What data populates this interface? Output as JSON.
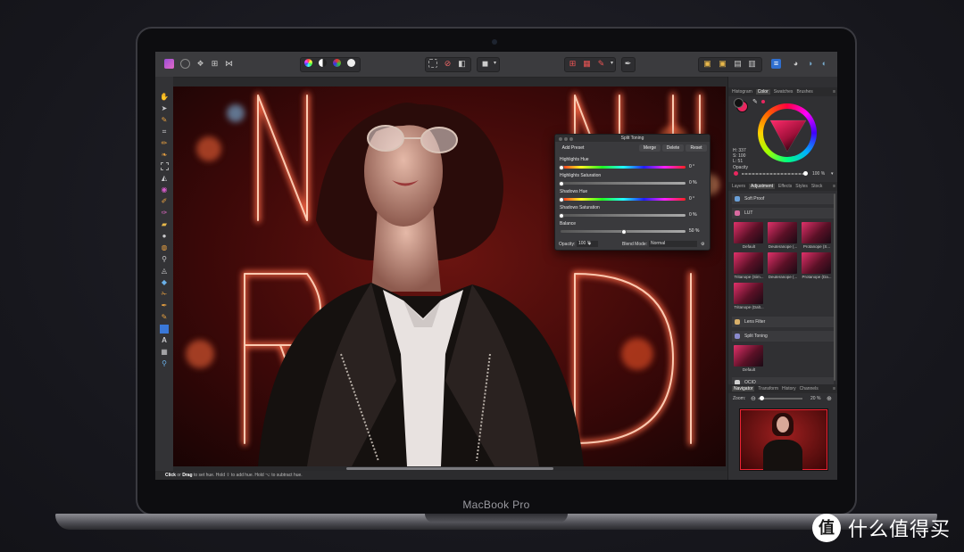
{
  "device": {
    "label": "MacBook Pro"
  },
  "app": {
    "status_hint_parts": [
      {
        "text": "Click",
        "bold": true
      },
      {
        "text": " or ",
        "bold": false
      },
      {
        "text": "Drag",
        "bold": true
      },
      {
        "text": " to set hue. Hold ⇧ to add hue. Hold ⌥ to subtract hue.",
        "bold": false
      }
    ]
  },
  "toolbar": {
    "left_icons": [
      "app-logo-icon",
      "persona-photo-icon",
      "persona-liquify-icon",
      "persona-develop-icon",
      "persona-export-icon"
    ],
    "mid_icons": [
      "auto-levels-icon",
      "auto-contrast-icon",
      "auto-colors-icon",
      "auto-white-balance-icon"
    ],
    "select_icons": [
      "marquee-icon",
      "deselect-icon",
      "invert-selection-icon"
    ],
    "quickmask": "quick-mask-icon",
    "snap_icons": [
      "snapping-icon",
      "grid-icon",
      "brush-icon"
    ],
    "arrange_icons": [
      "arrange-back-icon",
      "arrange-front-icon",
      "arrange-icon"
    ],
    "right_icons": [
      "view-mode-icon",
      "boolean-add-icon",
      "boolean-subtract-icon",
      "boolean-intersect-icon"
    ]
  },
  "tools": [
    "hand-tool-icon",
    "move-tool-icon",
    "color-picker-icon",
    "crop-tool-icon",
    "paint-brush-icon",
    "smudge-icon",
    "selection-brush-icon",
    "flood-fill-icon",
    "gradient-icon",
    "paint-icon",
    "pixel-icon",
    "erase-icon",
    "dodge-icon",
    "sponge-icon",
    "clone-icon",
    "blur-icon",
    "sharpen-icon",
    "retouch-icon",
    "pen-icon",
    "node-icon",
    "shape-icon",
    "text-icon",
    "mesh-warp-icon",
    "zoom-tool-icon"
  ],
  "split_toning": {
    "title": "Split Toning",
    "buttons": {
      "add_preset": "Add Preset",
      "merge": "Merge",
      "delete": "Delete",
      "reset": "Reset"
    },
    "controls": [
      {
        "label": "Highlights Hue",
        "value": "0 °",
        "position": 0.0,
        "kind": "hue"
      },
      {
        "label": "Highlights Saturation",
        "value": "0 %",
        "position": 0.0,
        "kind": "gray"
      },
      {
        "label": "Shadows Hue",
        "value": "0 °",
        "position": 0.0,
        "kind": "hue"
      },
      {
        "label": "Shadows Saturation",
        "value": "0 %",
        "position": 0.0,
        "kind": "gray"
      },
      {
        "label": "Balance",
        "value": "50 %",
        "position": 0.5,
        "kind": "gray"
      }
    ],
    "opacity_label": "Opacity:",
    "opacity_value": "100 %",
    "blend_label": "Blend Mode:",
    "blend_value": "Normal"
  },
  "color_panel": {
    "tabs": [
      "Histogram",
      "Color",
      "Swatches",
      "Brushes"
    ],
    "active_tab": "Color",
    "readout_h": "H: 337",
    "readout_s": "S: 100",
    "readout_l": "L: 51",
    "opacity_label": "Opacity",
    "opacity_value": "100 %",
    "accent": "#e8275f"
  },
  "adjustment_panel": {
    "tabs": [
      "Layers",
      "Adjustment",
      "Effects",
      "Styles",
      "Stock"
    ],
    "active_tab": "Adjustment",
    "items": [
      {
        "label": "Soft Proof",
        "color": "#6aa0d8"
      },
      {
        "label": "LUT",
        "color": "#d86aa0"
      }
    ],
    "lut_thumbs": [
      "Default",
      "Deuteranope (...",
      "Protanope (S...",
      "Tritanope (Sim...",
      "Deuteranope (...",
      "Protanope (Da...",
      "Tritanope (Dalt..."
    ],
    "items2": [
      {
        "label": "Lens Filter",
        "color": "#d8b06a"
      },
      {
        "label": "Split Toning",
        "color": "#8a8acd"
      }
    ],
    "split_thumb": "Default",
    "ocio": "OCIO"
  },
  "navigator_panel": {
    "tabs": [
      "Navigator",
      "Transform",
      "History",
      "Channels"
    ],
    "active_tab": "Navigator",
    "zoom_label": "Zoom:",
    "zoom_value": "20 %"
  },
  "watermark": {
    "badge": "值",
    "text": "什么值得买"
  }
}
